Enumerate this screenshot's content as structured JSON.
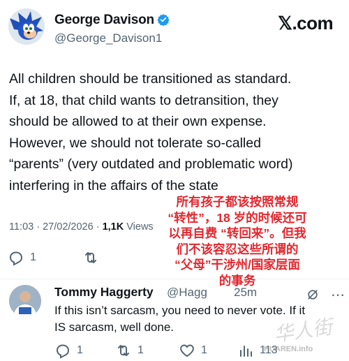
{
  "brand": {
    "text": "𝕏.com"
  },
  "tweet": {
    "author_name": "George Davison",
    "handle": "@George_Davison1",
    "text": "All children should be transitioned as standard.\nIf, at 18, that child wants to detransition, they\nshould be allowed to at their own expense.\nHowever, we should not tolerate so-called\n“parents” (very outdated and problematic word)\ninterfering in the affairs of the state",
    "time": "11:03",
    "date": "27/02/2026",
    "views_count": "1,1K",
    "views_label": "Views",
    "replies": "1"
  },
  "reply": {
    "author_name": "Tommy Haggerty",
    "handle": "@Hagg",
    "time": "25m",
    "text": "If this isn’t sarcasm, you need to never vote.  If it\nIS sarcasm, well done.",
    "reply_count": "1",
    "retweet_count": "1",
    "like_count": "1",
    "views_count": "113"
  },
  "overlay": {
    "caption": "所有孩子都该按照常规\n“转性”，18 岁的时候还可\n以再自费 “转回来”。但我\n们不该容忍这些所谓的\n“父母”干涉州/国家层面\n的事务"
  },
  "watermark": {
    "text": "华人街",
    "url": "HUAREN.info"
  },
  "colors": {
    "verified": "#1d9bf0",
    "caption": "#e3262d",
    "muted": "#536471"
  }
}
